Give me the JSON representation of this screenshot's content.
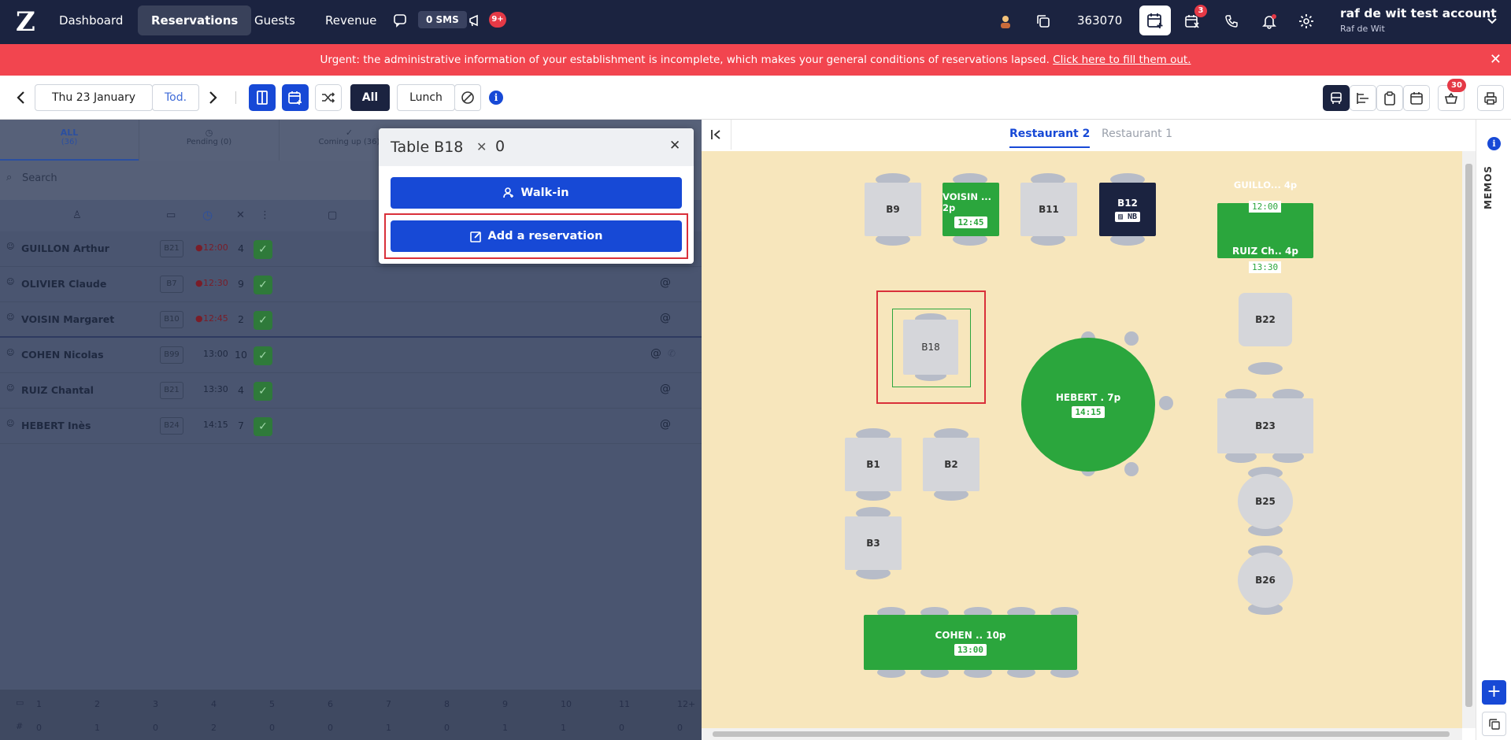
{
  "nav": {
    "items": [
      {
        "label": "Dashboard",
        "active": false
      },
      {
        "label": "Reservations",
        "active": true
      },
      {
        "label": "Guests",
        "active": false
      },
      {
        "label": "Revenue",
        "active": false
      }
    ],
    "sms_label": "0 SMS",
    "announce_badge": "9+",
    "counter": "363070",
    "waitlist_badge": "3",
    "account_name": "raf de wit test account",
    "account_user": "Raf de Wit"
  },
  "banner": {
    "text": "Urgent: the administrative information of your establishment is incomplete, which makes your general conditions of reservations lapsed.",
    "link": "Click here to fill them out."
  },
  "toolbar": {
    "date": "Thu 23 January",
    "today": "Tod.",
    "filter_all": "All",
    "service": "Lunch",
    "basket_badge": "30"
  },
  "list": {
    "tabs": [
      {
        "label": "ALL",
        "count": "(36)"
      },
      {
        "label": "Pending (0)",
        "count": ""
      },
      {
        "label": "Coming up (36)",
        "count": ""
      }
    ],
    "search_placeholder": "Search",
    "rows": [
      {
        "name": "GUILLON Arthur",
        "table": "B21",
        "time": "12:00",
        "late": true,
        "covers": "4",
        "contact": ""
      },
      {
        "name": "OLIVIER Claude",
        "table": "B7",
        "time": "12:30",
        "late": true,
        "covers": "9",
        "contact": "@"
      },
      {
        "name": "VOISIN Margaret",
        "table": "B10",
        "time": "12:45",
        "late": true,
        "covers": "2",
        "contact": "@"
      },
      {
        "name": "COHEN Nicolas",
        "table": "B99",
        "time": "13:00",
        "late": false,
        "covers": "10",
        "contact": "@"
      },
      {
        "name": "RUIZ Chantal",
        "table": "B21",
        "time": "13:30",
        "late": false,
        "covers": "4",
        "contact": "@"
      },
      {
        "name": "HEBERT Inès",
        "table": "B24",
        "time": "14:15",
        "late": false,
        "covers": "7",
        "contact": "@"
      }
    ],
    "footer_sizes": [
      "1",
      "2",
      "3",
      "4",
      "5",
      "6",
      "7",
      "8",
      "9",
      "10",
      "11",
      "12+"
    ],
    "footer_counts": [
      "0",
      "1",
      "0",
      "2",
      "0",
      "0",
      "1",
      "0",
      "1",
      "1",
      "0",
      "0"
    ]
  },
  "popup": {
    "title": "Table B18",
    "covers": "0",
    "walkin": "Walk-in",
    "add_reservation": "Add a reservation"
  },
  "floor": {
    "tabs": [
      {
        "label": "Restaurant 2",
        "active": true
      },
      {
        "label": "Restaurant 1",
        "active": false
      }
    ],
    "memos": "MEMOS",
    "tables": [
      {
        "id": "B9",
        "label": "B9"
      },
      {
        "id": "B10",
        "label": "VOISIN ... 2p",
        "time": "12:45"
      },
      {
        "id": "B11",
        "label": "B11"
      },
      {
        "id": "B12",
        "label": "B12",
        "tag": "NB"
      },
      {
        "id": "B21a",
        "label": "GUILLO... 4p",
        "time": "12:00"
      },
      {
        "id": "B21b",
        "label": "RUIZ Ch.. 4p",
        "time": "13:30"
      },
      {
        "id": "B18",
        "label": "B18"
      },
      {
        "id": "B22",
        "label": "B22"
      },
      {
        "id": "B24",
        "label": "HEBERT . 7p",
        "time": "14:15"
      },
      {
        "id": "B23",
        "label": "B23"
      },
      {
        "id": "B1",
        "label": "B1"
      },
      {
        "id": "B2",
        "label": "B2"
      },
      {
        "id": "B25",
        "label": "B25"
      },
      {
        "id": "B3",
        "label": "B3"
      },
      {
        "id": "B26",
        "label": "B26"
      },
      {
        "id": "B99",
        "label": "COHEN .. 10p",
        "time": "13:00"
      }
    ]
  },
  "colors": {
    "navy": "#1b2340",
    "accent": "#1749d6",
    "green": "#2ba63d",
    "alert": "#f2454f"
  }
}
